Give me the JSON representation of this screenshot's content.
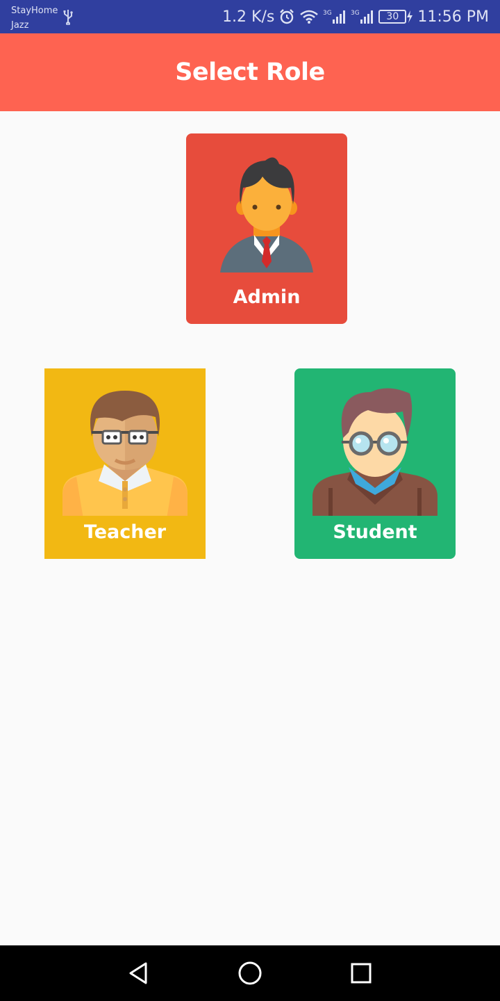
{
  "status_bar": {
    "carrier_line1": "StayHome",
    "carrier_line2": "Jazz",
    "net_speed": "1.2 K/s",
    "battery": "30",
    "time": "11:56 PM",
    "network1": "3G",
    "network2": "3G"
  },
  "app_bar": {
    "title": "Select Role"
  },
  "roles": [
    {
      "label": "Admin",
      "color": "#e74c3c"
    },
    {
      "label": "Teacher",
      "color": "#f2b813"
    },
    {
      "label": "Student",
      "color": "#22b573"
    }
  ],
  "colors": {
    "status_bar": "#303f9f",
    "app_bar": "#fe6351",
    "background": "#fafafa"
  },
  "icons": [
    "usb-icon",
    "alarm-icon",
    "wifi-icon",
    "signal-icon",
    "battery-icon",
    "back-icon",
    "home-icon",
    "recents-icon"
  ]
}
